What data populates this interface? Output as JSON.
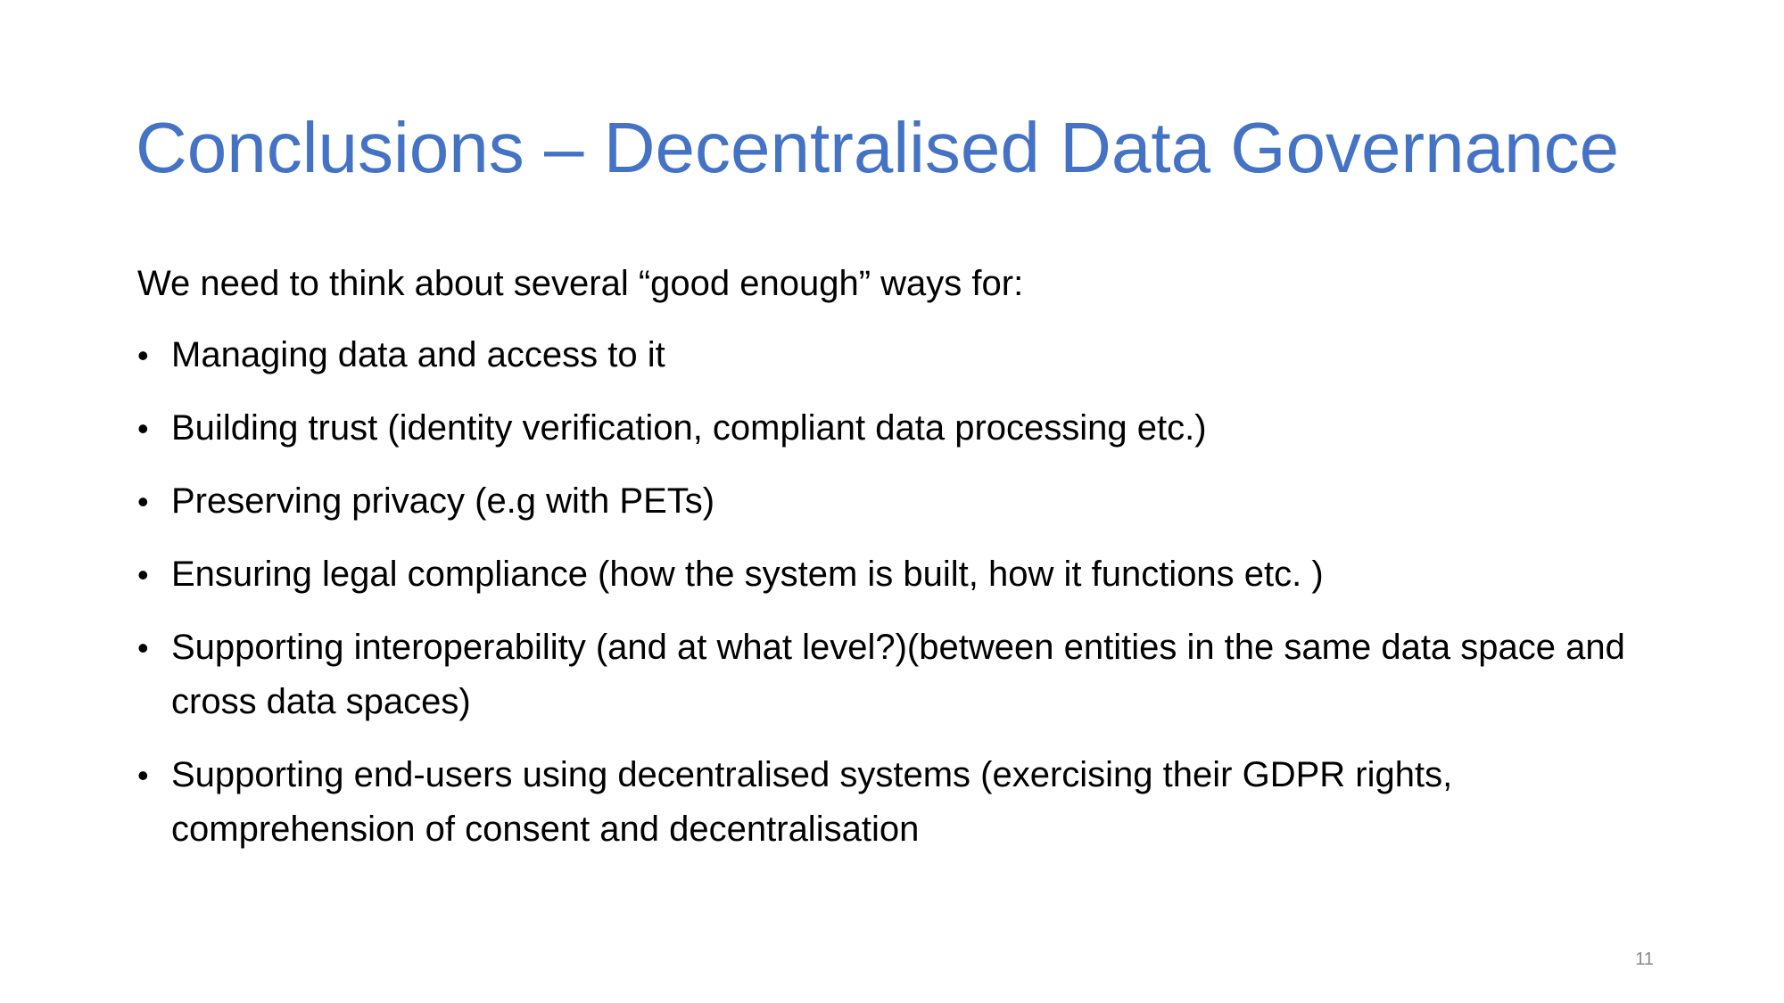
{
  "slide": {
    "title": "Conclusions – Decentralised Data Governance",
    "intro": "We need to think about several “good enough” ways for:",
    "bullets": [
      "Managing data and access to it",
      "Building trust (identity verification, compliant data processing etc.)",
      "Preserving privacy (e.g with PETs)",
      "Ensuring legal compliance (how the system is built, how it functions etc. )",
      "Supporting interoperability (and at what level?)(between entities in the same data space and cross data spaces)",
      "Supporting end-users using decentralised systems (exercising their GDPR rights, comprehension of consent and decentralisation"
    ],
    "page_number": "11"
  },
  "colors": {
    "title": "#4472c4",
    "body_text": "#000000",
    "page_number": "#898989",
    "background": "#ffffff"
  }
}
